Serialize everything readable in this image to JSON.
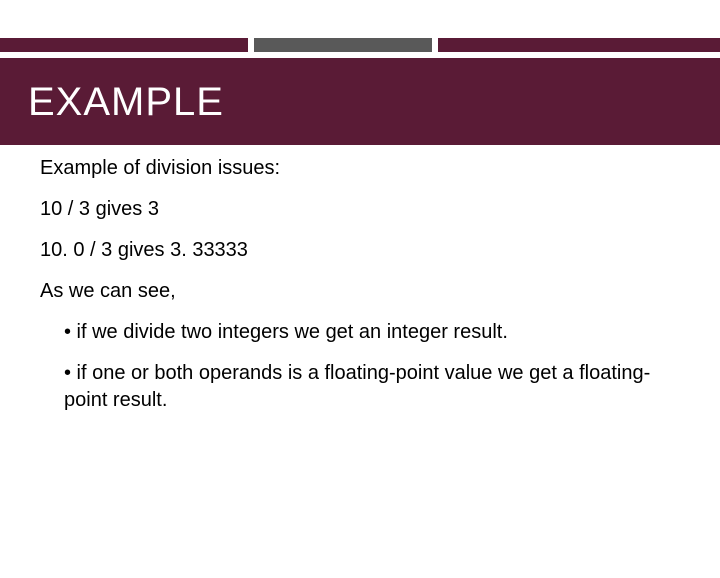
{
  "title": "EXAMPLE",
  "body": {
    "intro": "Example of division issues:",
    "ex1": "10 / 3  gives  3",
    "ex2": "10. 0 / 3 gives 3. 33333",
    "lead": "As we can see,",
    "bullet1": "• if we divide two integers we get an integer result.",
    "bullet2": "• if one or both operands is a floating-point value we get a floating-point result."
  }
}
